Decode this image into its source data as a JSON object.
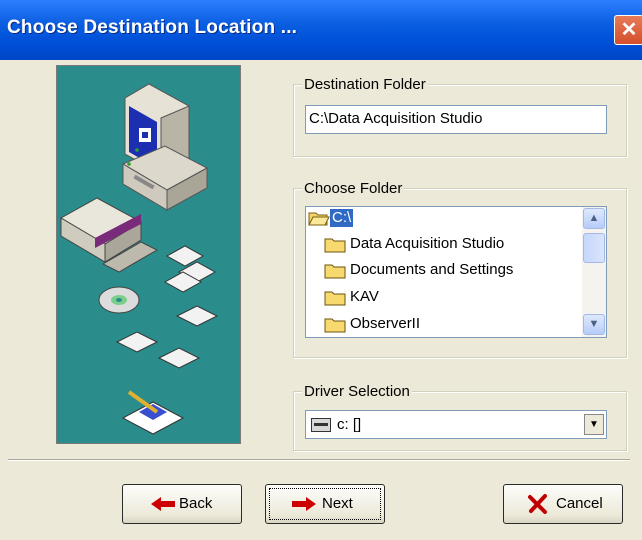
{
  "window": {
    "title": "Choose Destination Location ..."
  },
  "destination": {
    "group_label": "Destination Folder",
    "path": "C:\\Data Acquisition Studio"
  },
  "folders": {
    "group_label": "Choose Folder",
    "items": [
      {
        "label": "C:\\",
        "icon": "open-folder-icon",
        "selected": true
      },
      {
        "label": "Data Acquisition Studio",
        "icon": "folder-icon",
        "selected": false
      },
      {
        "label": "Documents and Settings",
        "icon": "folder-icon",
        "selected": false
      },
      {
        "label": "KAV",
        "icon": "folder-icon",
        "selected": false
      },
      {
        "label": "ObserverII",
        "icon": "folder-icon",
        "selected": false
      }
    ]
  },
  "drive": {
    "group_label": "Driver Selection",
    "value": "c: []"
  },
  "buttons": {
    "back_label": "Back",
    "next_label": "Next",
    "cancel_label": "Cancel"
  },
  "colors": {
    "title_bar": "#0050d8",
    "artwork_background": "#2b8c8c",
    "selection": "#316ac5",
    "dialog_background": "#ece9d8"
  }
}
